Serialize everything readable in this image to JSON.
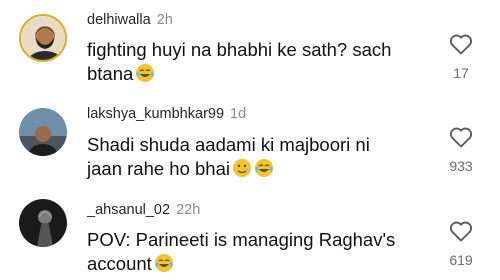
{
  "comments": [
    {
      "username": "delhiwalla",
      "time": "2h",
      "line1": "fighting huyi na bhabhi ke sath? sach",
      "line2": "btana",
      "emojis": [
        "face-with-tears-of-joy"
      ],
      "likes": "17"
    },
    {
      "username": "lakshya_kumbhkar99",
      "time": "1d",
      "line1": "Shadi shuda aadami ki majboori ni",
      "line2": "jaan rahe ho bhai",
      "emojis": [
        "smiling-face-with-tear",
        "face-with-tears-of-joy"
      ],
      "likes": "933"
    },
    {
      "username": "_ahsanul_02",
      "time": "22h",
      "line1": "POV: Parineeti is managing Raghav's",
      "line2": "account",
      "emojis": [
        "face-with-tears-of-joy"
      ],
      "likes": "619"
    }
  ],
  "colors": {
    "username": "#262626",
    "time": "#8a8a8a",
    "likes": "#6b6b6b",
    "emoji": "#f4c430"
  }
}
